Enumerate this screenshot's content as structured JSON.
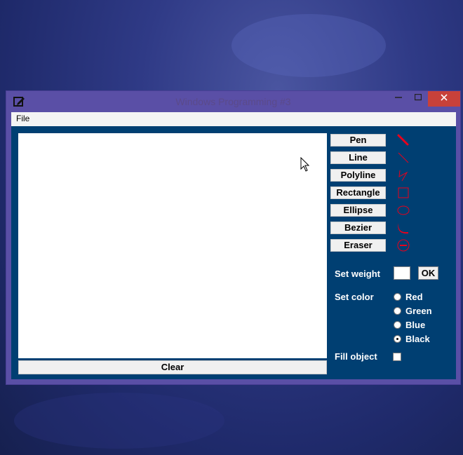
{
  "window": {
    "title": "Windows Programming #3"
  },
  "menu": {
    "file": "File"
  },
  "tools": [
    {
      "label": "Pen",
      "icon": "pen-icon"
    },
    {
      "label": "Line",
      "icon": "line-icon"
    },
    {
      "label": "Polyline",
      "icon": "polyline-icon"
    },
    {
      "label": "Rectangle",
      "icon": "rectangle-icon"
    },
    {
      "label": "Ellipse",
      "icon": "ellipse-icon"
    },
    {
      "label": "Bezier",
      "icon": "bezier-icon"
    },
    {
      "label": "Eraser",
      "icon": "eraser-icon"
    }
  ],
  "weight": {
    "label": "Set weight",
    "value": "",
    "ok": "OK"
  },
  "color": {
    "label": "Set color",
    "options": [
      "Red",
      "Green",
      "Blue",
      "Black"
    ],
    "selected": "Black"
  },
  "fill": {
    "label": "Fill object",
    "checked": false
  },
  "clear": "Clear",
  "colors": {
    "accent_red": "#e8001c",
    "client_bg": "#003f72",
    "frame": "#5a4fa6"
  }
}
